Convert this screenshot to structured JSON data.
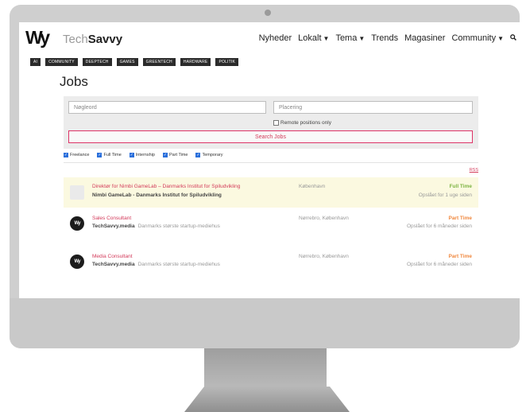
{
  "site": {
    "logo_mark": "Wy",
    "brand_light": "Tech",
    "brand_bold": "Savvy"
  },
  "nav": {
    "items": [
      {
        "label": "Nyheder",
        "dropdown": false
      },
      {
        "label": "Lokalt",
        "dropdown": true
      },
      {
        "label": "Tema",
        "dropdown": true
      },
      {
        "label": "Trends",
        "dropdown": false
      },
      {
        "label": "Magasiner",
        "dropdown": false
      },
      {
        "label": "Community",
        "dropdown": true
      }
    ],
    "search_icon": "search-icon"
  },
  "tags": [
    "AI",
    "COMMUNITY",
    "DEEPTECH",
    "GAMES",
    "GREENTECH",
    "HARDWARE",
    "POLITIK"
  ],
  "page": {
    "title": "Jobs"
  },
  "search": {
    "keywords_placeholder": "Nøgleord",
    "location_placeholder": "Placering",
    "remote_label": "Remote positions only",
    "remote_checked": false,
    "button_label": "Search Jobs"
  },
  "filters": [
    {
      "label": "Freelance",
      "checked": true
    },
    {
      "label": "Full Time",
      "checked": true
    },
    {
      "label": "Internship",
      "checked": true
    },
    {
      "label": "Part Time",
      "checked": true
    },
    {
      "label": "Temporary",
      "checked": true
    }
  ],
  "rss_label": "RSS",
  "jobs": [
    {
      "title": "Direktør for Nimbi GameLab – Danmarks Institut for Spiludvikling",
      "company": "Nimbi GameLab - Danmarks Institut for Spiludvikling",
      "tagline": "",
      "location": "København",
      "type": "Full Time",
      "posted": "Opslået for 1 uge siden",
      "featured": true,
      "logo": "placeholder-logo"
    },
    {
      "title": "Sales Consultant",
      "company": "TechSavvy.media",
      "tagline": "Danmarks største startup-mediehus",
      "location": "Nørrebro, København",
      "type": "Part Time",
      "posted": "Opslået for 6 måneder siden",
      "featured": false,
      "logo": "techsavvy-logo"
    },
    {
      "title": "Media Consultant",
      "company": "TechSavvy.media",
      "tagline": "Danmarks største startup-mediehus",
      "location": "Nørrebro, København",
      "type": "Part Time",
      "posted": "Opslået for 6 måneder siden",
      "featured": false,
      "logo": "techsavvy-logo"
    }
  ],
  "colors": {
    "accent": "#d33a5a",
    "full_time": "#7cb342",
    "part_time": "#f0883e",
    "featured_bg": "#fbf9e0",
    "checkbox": "#2a6fdb"
  }
}
